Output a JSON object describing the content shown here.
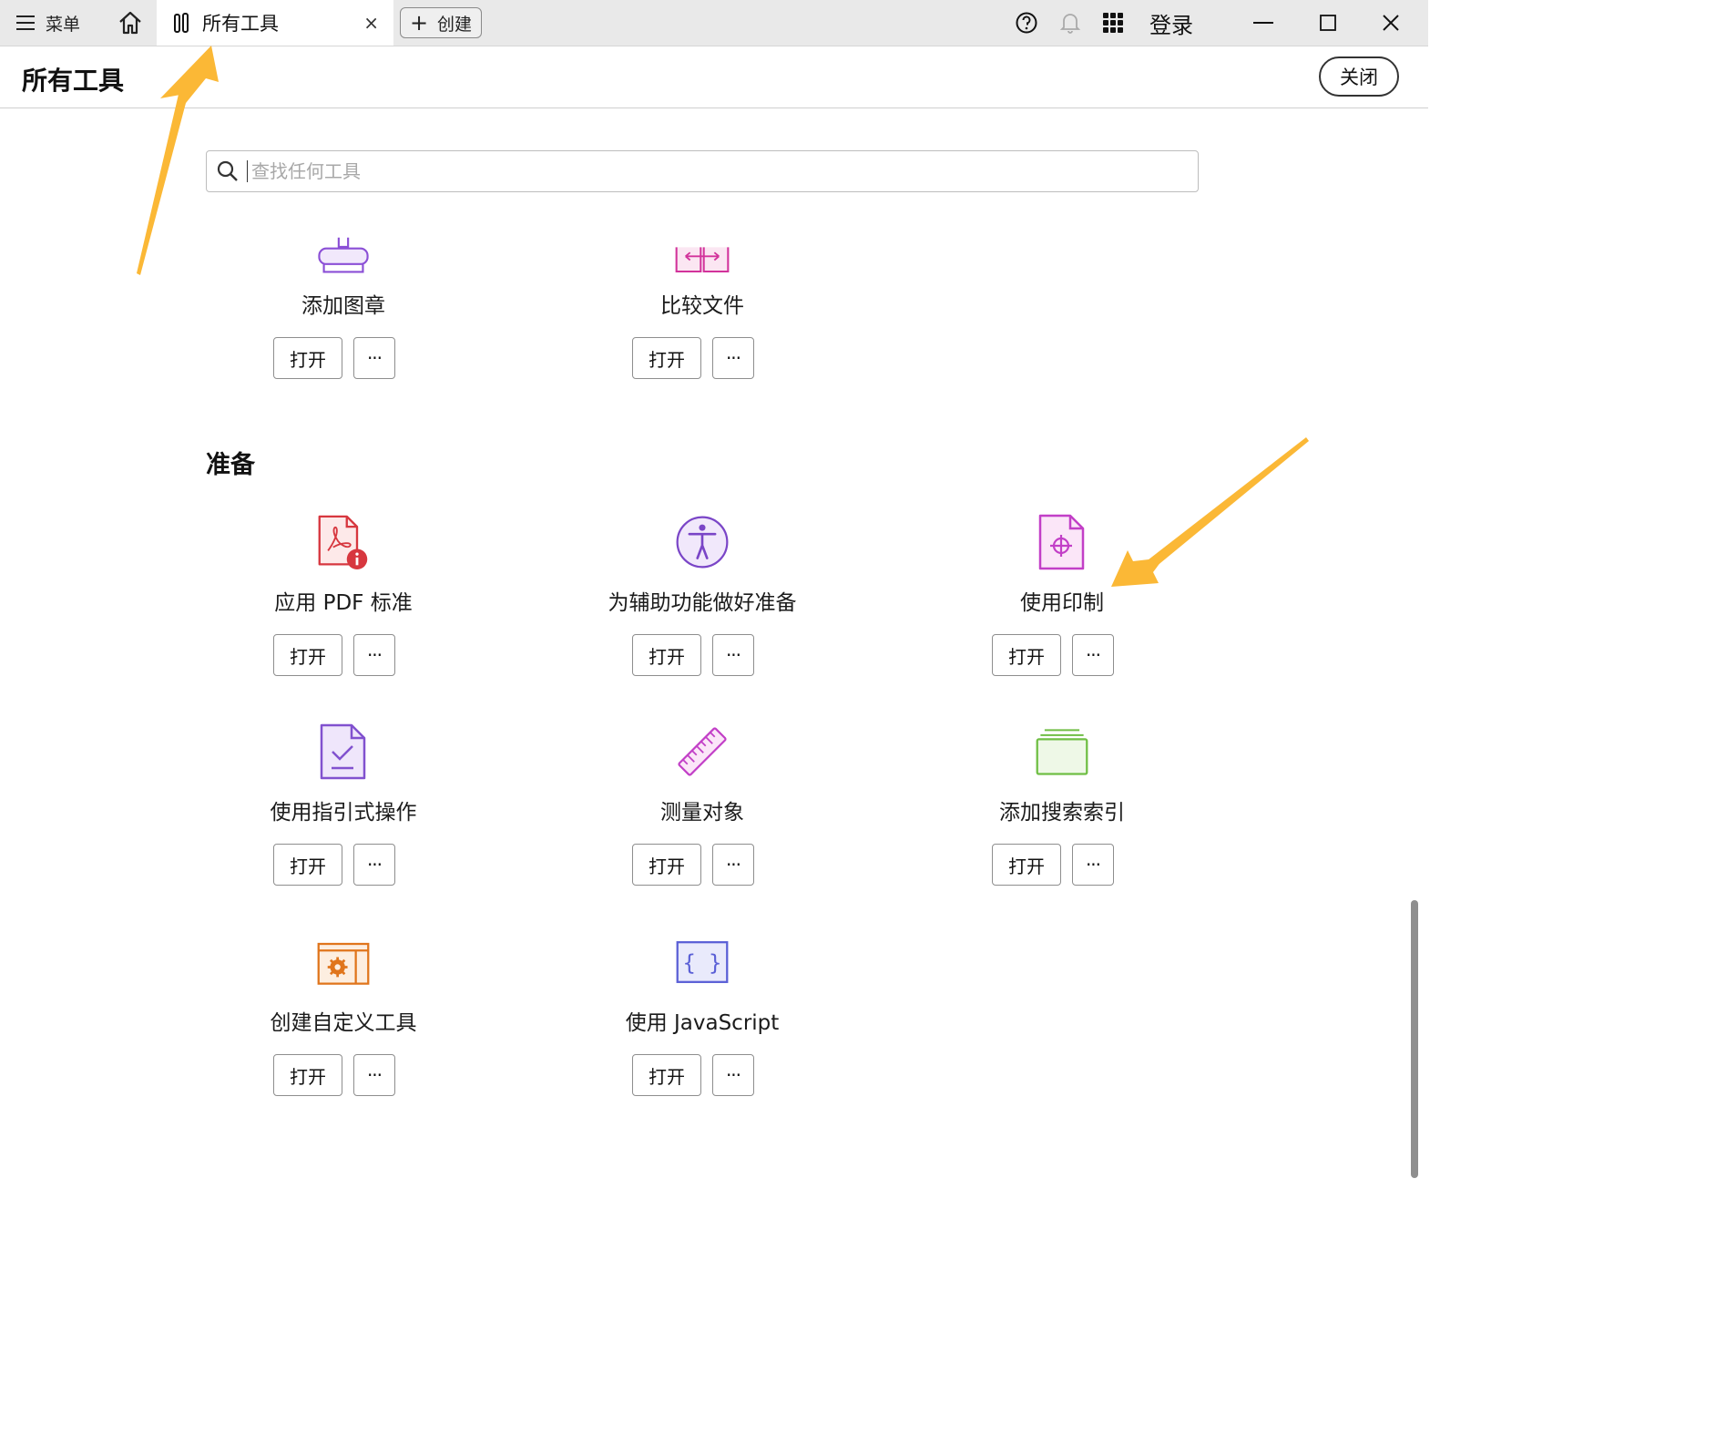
{
  "titlebar": {
    "menu_label": "菜单",
    "tab_label": "所有工具",
    "tab_close": "×",
    "create_label": "创建",
    "login_label": "登录"
  },
  "header": {
    "title": "所有工具",
    "close_label": "关闭"
  },
  "search": {
    "placeholder": "查找任何工具"
  },
  "top_tools": [
    {
      "name": "添加图章",
      "open": "打开",
      "more": "···",
      "icon": "stamp-icon",
      "color": "#8b4fd6"
    },
    {
      "name": "比较文件",
      "open": "打开",
      "more": "···",
      "icon": "compare-icon",
      "color": "#d2339b"
    }
  ],
  "section": {
    "title": "准备",
    "tools": [
      {
        "name": "应用 PDF 标准",
        "open": "打开",
        "more": "···",
        "icon": "pdf-standard-icon",
        "color": "#d7373f"
      },
      {
        "name": "为辅助功能做好准备",
        "open": "打开",
        "more": "···",
        "icon": "accessibility-icon",
        "color": "#7a45c7"
      },
      {
        "name": "使用印制",
        "open": "打开",
        "more": "···",
        "icon": "print-production-icon",
        "color": "#c23fc7"
      },
      {
        "name": "使用指引式操作",
        "open": "打开",
        "more": "···",
        "icon": "guided-action-icon",
        "color": "#8151cf"
      },
      {
        "name": "测量对象",
        "open": "打开",
        "more": "···",
        "icon": "ruler-icon",
        "color": "#c23fc7"
      },
      {
        "name": "添加搜索索引",
        "open": "打开",
        "more": "···",
        "icon": "search-index-icon",
        "color": "#6fbe44"
      },
      {
        "name": "创建自定义工具",
        "open": "打开",
        "more": "···",
        "icon": "custom-tool-icon",
        "color": "#e0751c"
      },
      {
        "name": "使用 JavaScript",
        "open": "打开",
        "more": "···",
        "icon": "javascript-icon",
        "color": "#5a5fd6"
      }
    ]
  },
  "annotation_color": "#fbb836"
}
